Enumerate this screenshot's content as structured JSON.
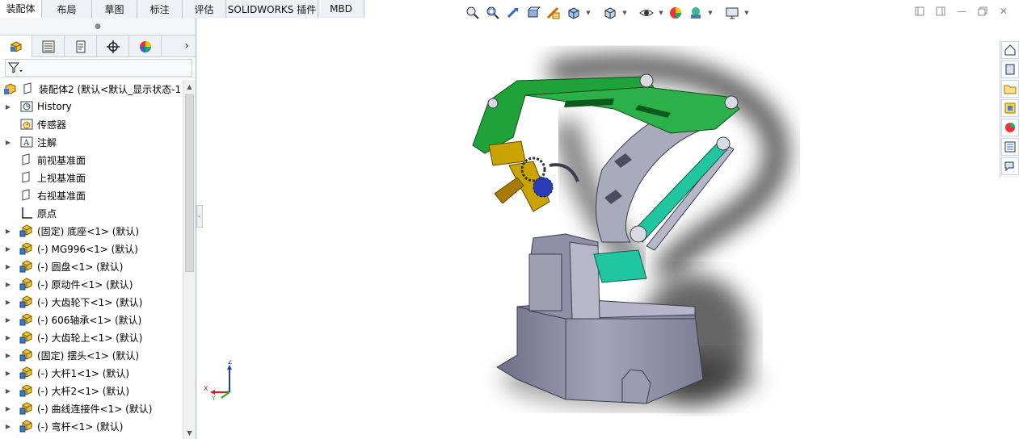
{
  "tabs": [
    "装配体",
    "布局",
    "草图",
    "标注",
    "评估",
    "SOLIDWORKS 插件",
    "MBD"
  ],
  "active_tab": 0,
  "manager_tabs": [
    "feature-manager",
    "property-manager",
    "configuration-manager",
    "dimxpert-manager",
    "display-manager"
  ],
  "tree": {
    "root": "装配体2 (默认<默认_显示状态-1",
    "items": [
      {
        "label": "History",
        "expand": true,
        "icon": "history"
      },
      {
        "label": "传感器",
        "expand": false,
        "icon": "sensor"
      },
      {
        "label": "注解",
        "expand": true,
        "icon": "annotation"
      },
      {
        "label": "前视基准面",
        "expand": false,
        "icon": "plane"
      },
      {
        "label": "上视基准面",
        "expand": false,
        "icon": "plane"
      },
      {
        "label": "右视基准面",
        "expand": false,
        "icon": "plane"
      },
      {
        "label": "原点",
        "expand": false,
        "icon": "origin"
      },
      {
        "label": "(固定) 底座<1> (默认)",
        "expand": true,
        "icon": "part"
      },
      {
        "label": "(-) MG996<1> (默认)",
        "expand": true,
        "icon": "part"
      },
      {
        "label": "(-) 圆盘<1> (默认)",
        "expand": true,
        "icon": "part"
      },
      {
        "label": "(-) 原动件<1> (默认)",
        "expand": true,
        "icon": "part"
      },
      {
        "label": "(-) 大齿轮下<1> (默认)",
        "expand": true,
        "icon": "part"
      },
      {
        "label": "(-) 606轴承<1> (默认)",
        "expand": true,
        "icon": "part"
      },
      {
        "label": "(-) 大齿轮上<1> (默认)",
        "expand": true,
        "icon": "part"
      },
      {
        "label": "(固定) 摆头<1> (默认)",
        "expand": true,
        "icon": "part"
      },
      {
        "label": "(-) 大杆1<1> (默认)",
        "expand": true,
        "icon": "part"
      },
      {
        "label": "(-) 大杆2<1> (默认)",
        "expand": true,
        "icon": "part"
      },
      {
        "label": "(-) 曲线连接件<1> (默认)",
        "expand": true,
        "icon": "part"
      },
      {
        "label": "(-) 弯杆<1> (默认)",
        "expand": true,
        "icon": "part"
      }
    ]
  },
  "triad": {
    "x": "X",
    "y": "Y",
    "z": "Z"
  },
  "colors": {
    "green": "#1fa23a",
    "teal": "#1fc6a0",
    "grey": "#8e8fa6",
    "gold": "#c9a400"
  }
}
